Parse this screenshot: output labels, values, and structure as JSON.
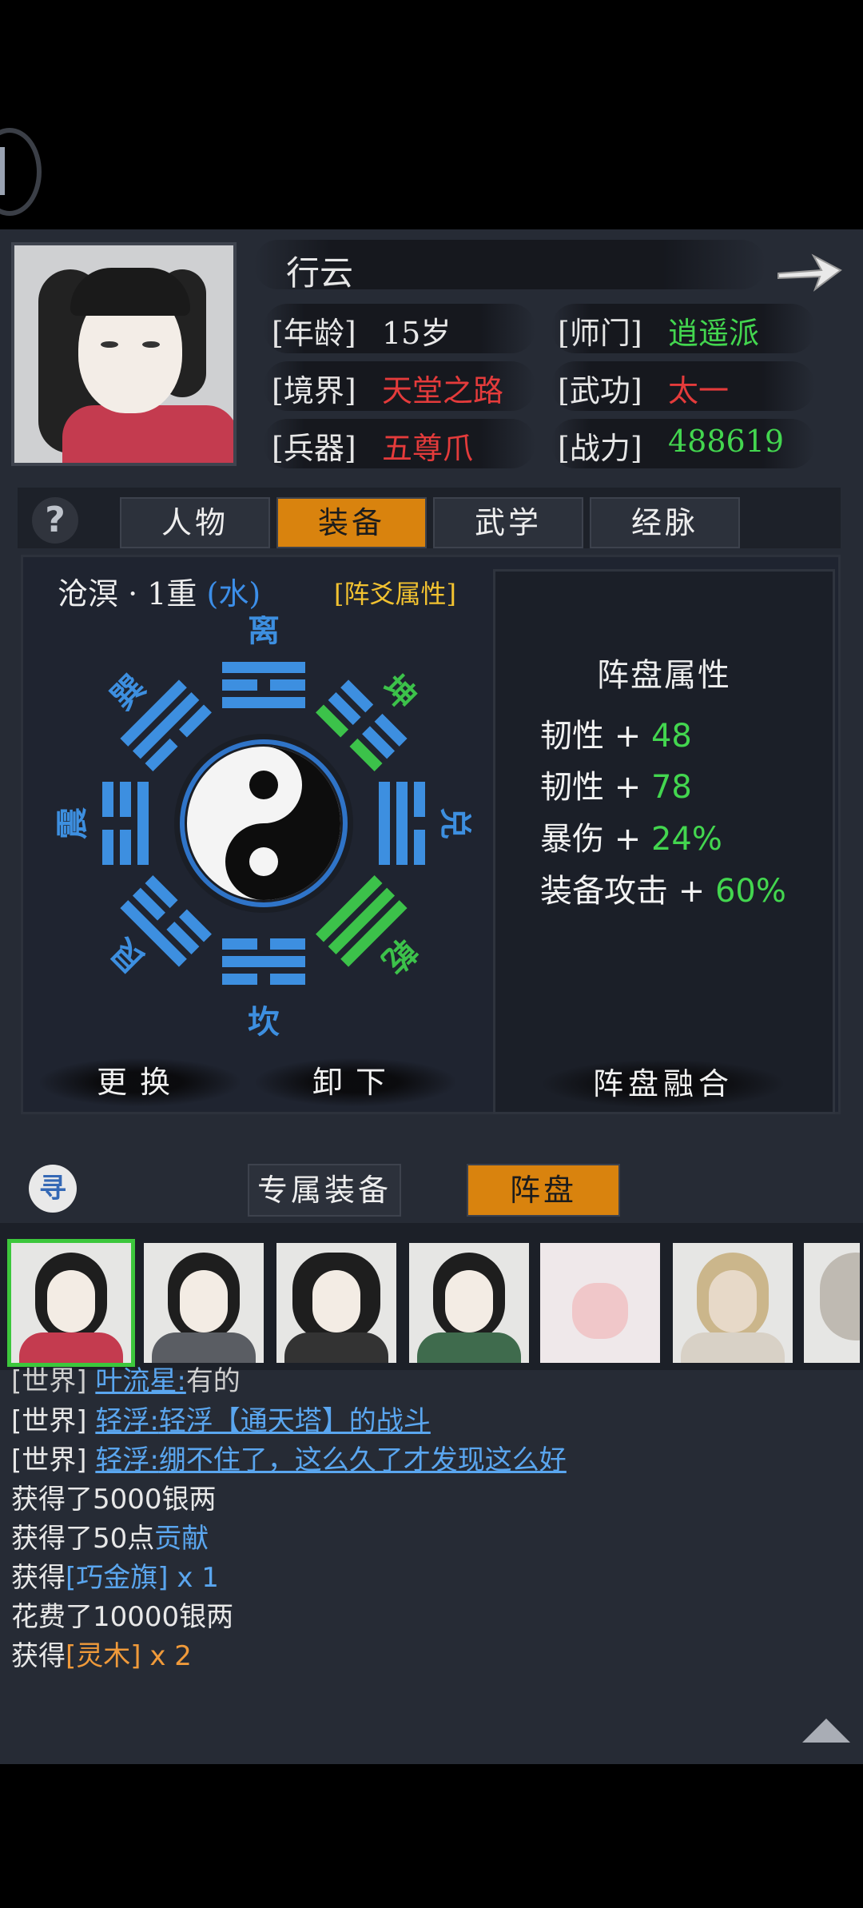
{
  "character": {
    "name": "行云",
    "rows": [
      {
        "label": "[年龄]",
        "value": "15岁",
        "label2": "[师门]",
        "value2": "逍遥派"
      },
      {
        "label": "[境界]",
        "value": "天堂之路",
        "label2": "[武功]",
        "value2": "太一"
      },
      {
        "label": "[兵器]",
        "value": "五尊爪",
        "label2": "[战力]",
        "value2": "488619"
      }
    ]
  },
  "tabs": [
    "人物",
    "装备",
    "武学",
    "经脉"
  ],
  "active_tab": "装备",
  "help_icon": "?",
  "formation": {
    "title": "沧溟 · 1重",
    "element": "(水)",
    "attr_link": "[阵爻属性]",
    "trigrams": [
      "离",
      "坤",
      "兑",
      "乾",
      "坎",
      "艮",
      "震",
      "巽"
    ],
    "buttons": {
      "replace": "更换",
      "unload": "卸下",
      "fuse": "阵盘融合"
    }
  },
  "attributes": {
    "title": "阵盘属性",
    "items": [
      {
        "name": "韧性",
        "op": "+",
        "value": "48"
      },
      {
        "name": "韧性",
        "op": "+",
        "value": "78"
      },
      {
        "name": "暴伤",
        "op": "+",
        "value": "24%"
      },
      {
        "name": "装备攻击",
        "op": "+",
        "value": "60%"
      }
    ]
  },
  "bottom_tabs": [
    "专属装备",
    "阵盘"
  ],
  "bottom_logo": "寻",
  "chat": {
    "line1": {
      "tag": "[世界]",
      "user": "叶流星:",
      "msg": "有的"
    },
    "line2": {
      "tag": "[世界]",
      "user": "轻浮:",
      "msg": "轻浮【通天塔】的战斗"
    },
    "line3": {
      "tag": "[世界]",
      "user": "轻浮:",
      "msg": "绷不住了，这么久了才发现这么好"
    },
    "line4": {
      "text": "获得了5000银两"
    },
    "line5": {
      "pre": "获得了50点",
      "hl": "贡献"
    },
    "line6": {
      "pre": "获得",
      "hl": "[巧金旗]",
      "post": " x 1"
    },
    "line7": {
      "text": "花费了10000银两"
    },
    "line8": {
      "pre": "获得",
      "hl": "[灵木]",
      "post": " x 2"
    }
  },
  "colors": {
    "accent_orange": "#d9830e",
    "green": "#43d64f",
    "red": "#e43b3b",
    "blue": "#3c8ee8"
  }
}
